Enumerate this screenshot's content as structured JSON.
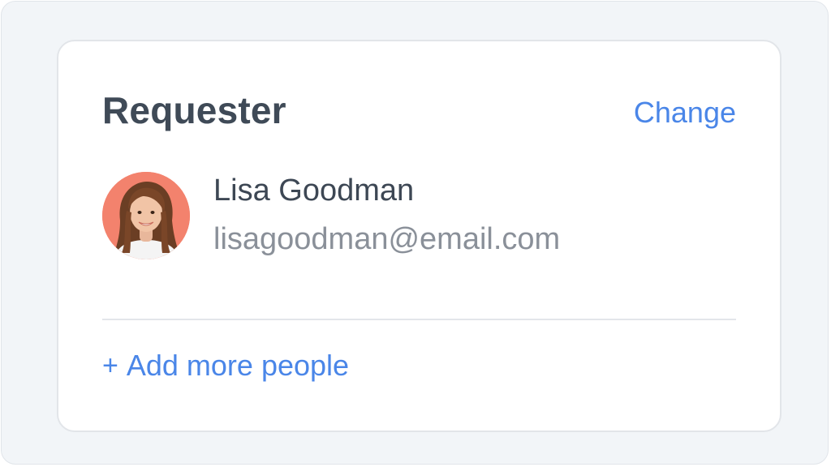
{
  "card": {
    "title": "Requester",
    "change_label": "Change"
  },
  "requester": {
    "name": "Lisa Goodman",
    "email": "lisagoodman@email.com",
    "avatar_icon": "user-avatar-photo",
    "avatar_bg": "#f3826d"
  },
  "actions": {
    "add_symbol": "+",
    "add_label": "Add more people"
  },
  "colors": {
    "accent": "#4a86e8",
    "title": "#3f4a57",
    "secondary_text": "#8a9099"
  }
}
